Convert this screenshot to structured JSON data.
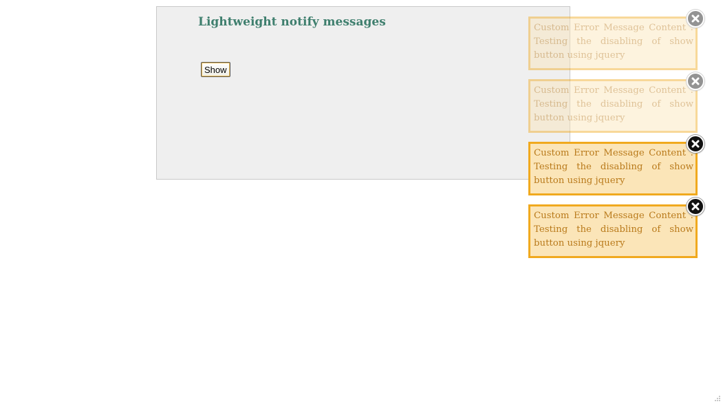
{
  "page": {
    "title": "Lightweight notify messages",
    "show_button_label": "Show"
  },
  "notifications": [
    {
      "message": "Custom Error Message Content : Testing the disabling of show button using jquery",
      "state": "fading",
      "close_icon": "close-icon"
    },
    {
      "message": "Custom Error Message Content : Testing the disabling of show button using jquery",
      "state": "fading",
      "close_icon": "close-icon"
    },
    {
      "message": "Custom Error Message Content : Testing the disabling of show button using jquery",
      "state": "active",
      "close_icon": "close-icon"
    },
    {
      "message": "Custom Error Message Content : Testing the disabling of show button using jquery",
      "state": "active",
      "close_icon": "close-icon"
    }
  ],
  "colors": {
    "panel_background": "#efefef",
    "title_color": "#3f7f6e",
    "notify_background": "#fbe5b8",
    "notify_border": "#f0a91e",
    "notify_text": "#b97a1b",
    "close_button": "#111111"
  }
}
